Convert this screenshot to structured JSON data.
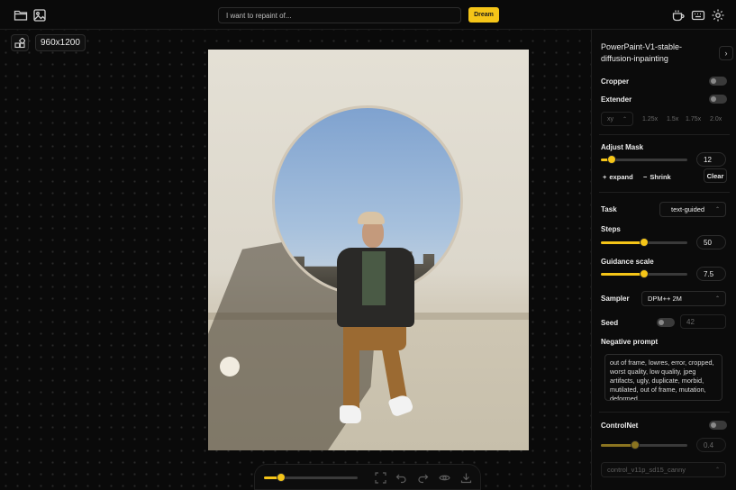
{
  "topbar": {
    "prompt_placeholder": "I want to repaint of...",
    "dream_label": "Dream",
    "icons": [
      "folder-icon",
      "image-icon",
      "coffee-icon",
      "keyboard-icon",
      "gear-icon"
    ]
  },
  "canvas": {
    "size_label": "960x1200"
  },
  "zoombar": {
    "zoom_level": 0.18,
    "icons": [
      "fit-screen-icon",
      "undo-icon",
      "redo-icon",
      "eye-icon",
      "download-icon"
    ]
  },
  "panel": {
    "model_name": "PowerPaint-V1-stable-diffusion-inpainting",
    "cropper": {
      "label": "Cropper",
      "enabled": false
    },
    "extender": {
      "label": "Extender",
      "enabled": false,
      "direction": "xy",
      "scales": [
        "1.25x",
        "1.5x",
        "1.75x",
        "2.0x"
      ]
    },
    "adjust_mask": {
      "label": "Adjust Mask",
      "value": "12",
      "fraction": 0.13,
      "expand_label": "expand",
      "shrink_label": "Shrink",
      "clear_label": "Clear"
    },
    "task": {
      "label": "Task",
      "value": "text-guided"
    },
    "steps": {
      "label": "Steps",
      "value": "50",
      "fraction": 0.5
    },
    "guidance": {
      "label": "Guidance scale",
      "value": "7.5",
      "fraction": 0.5
    },
    "sampler": {
      "label": "Sampler",
      "value": "DPM++ 2M"
    },
    "seed": {
      "label": "Seed",
      "value": "42",
      "enabled": false
    },
    "negative_prompt": {
      "label": "Negative prompt",
      "value": "out of frame, lowres, error, cropped, worst quality, low quality, jpeg artifacts, ugly, duplicate, morbid, mutilated, out of frame, mutation, deformed"
    },
    "controlnet": {
      "label": "ControlNet",
      "enabled": false,
      "value": "0.4",
      "fraction": 0.4,
      "model": "control_v11p_sd15_canny"
    }
  },
  "colors": {
    "accent": "#f5c518",
    "background": "#0a0a0a",
    "panel": "#0b0b0b"
  }
}
